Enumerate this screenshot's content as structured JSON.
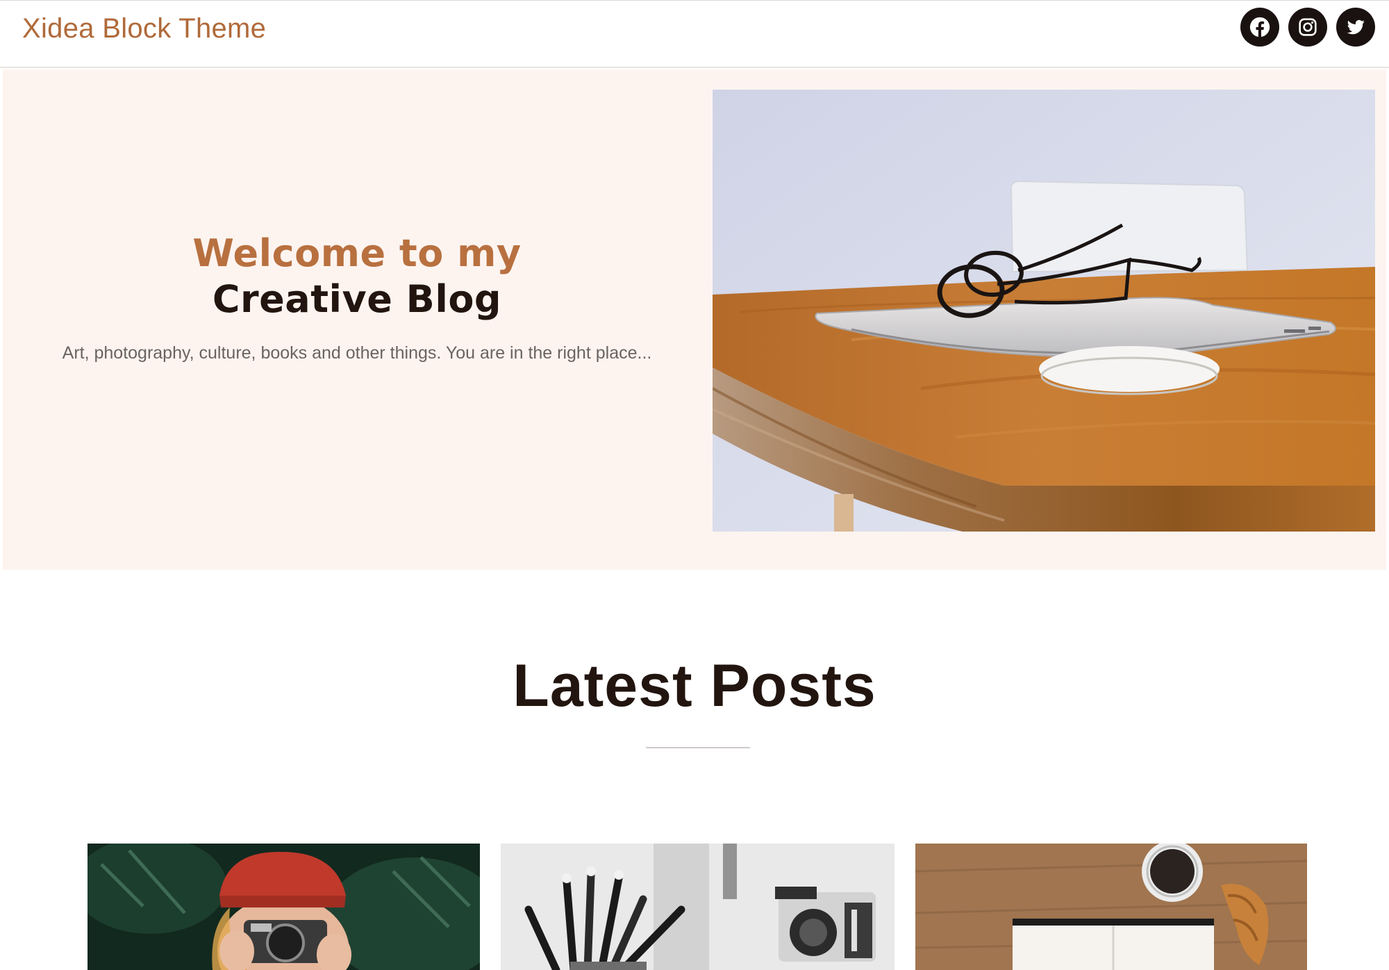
{
  "header": {
    "site_title": "Xidea Block Theme",
    "social": [
      {
        "name": "facebook-icon"
      },
      {
        "name": "instagram-icon"
      },
      {
        "name": "twitter-icon"
      }
    ]
  },
  "hero": {
    "heading_line1": "Welcome to my",
    "heading_line2": "Creative Blog",
    "description": "Art, photography, culture, books and other things. You are in the right place...",
    "image_alt": "Laptop with glasses and mouse on a wooden desk"
  },
  "latest_posts": {
    "title": "Latest Posts",
    "posts": [
      {
        "image_alt": "Woman in red beanie holding a camera"
      },
      {
        "image_alt": "Pencils in a cup and a camera"
      },
      {
        "image_alt": "Notebook, coffee cup and croissant on a wooden table"
      }
    ]
  },
  "colors": {
    "accent": "#b06a3a",
    "hero_background": "#fdf4f0",
    "heading_dark": "#22150f"
  }
}
